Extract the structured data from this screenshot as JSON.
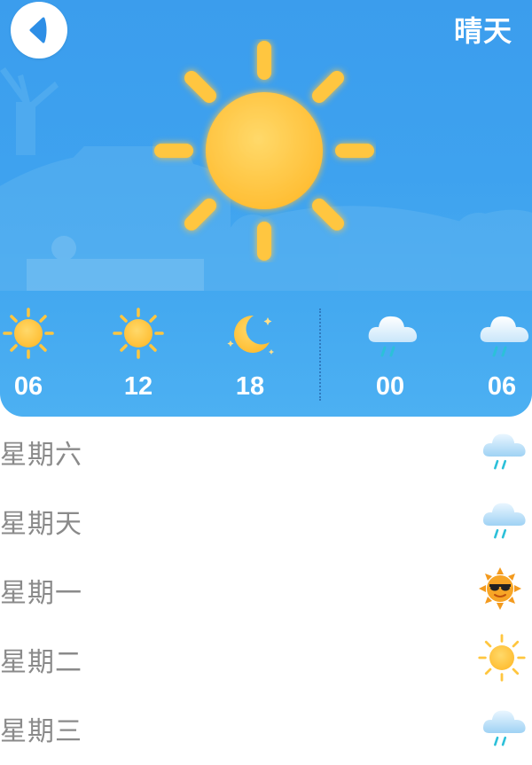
{
  "header": {
    "title": "晴天",
    "back_icon": "chevron-left-icon",
    "current_condition_icon": "sun-icon"
  },
  "colors": {
    "sky": "#3ea2ef",
    "sun": "#ffc63f",
    "day_text": "#8a8a8a"
  },
  "hourly": [
    {
      "time": "06",
      "icon": "sun-icon"
    },
    {
      "time": "12",
      "icon": "sun-icon"
    },
    {
      "time": "18",
      "icon": "moon-icon"
    },
    {
      "time": "00",
      "icon": "rain-cloud-icon"
    },
    {
      "time": "06",
      "icon": "rain-cloud-icon"
    }
  ],
  "daily": [
    {
      "day": "星期六",
      "icon": "rain-cloud-icon"
    },
    {
      "day": "星期天",
      "icon": "rain-cloud-icon"
    },
    {
      "day": "星期一",
      "icon": "sun-with-sunglasses-icon"
    },
    {
      "day": "星期二",
      "icon": "sun-icon"
    },
    {
      "day": "星期三",
      "icon": "rain-cloud-icon"
    }
  ]
}
